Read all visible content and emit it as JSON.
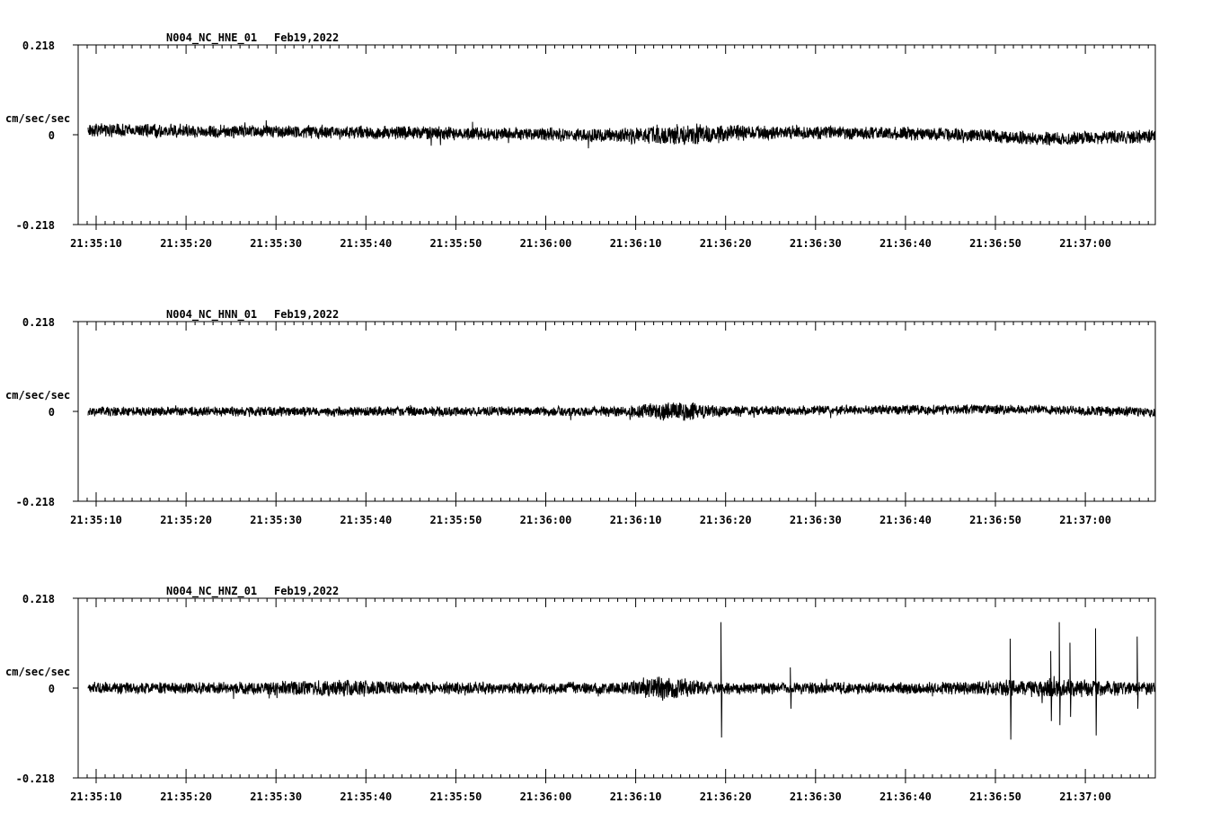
{
  "chart_data": [
    {
      "type": "line",
      "title": "N004_NC_HNE_01",
      "date": "Feb19,2022",
      "ylabel": "cm/sec/sec",
      "ylim": [
        -0.218,
        0.218
      ],
      "y_tick_labels": [
        "0.218",
        "0",
        "-0.218"
      ],
      "x_tick_labels": [
        "21:35:10",
        "21:35:20",
        "21:35:30",
        "21:35:40",
        "21:35:50",
        "21:36:00",
        "21:36:10",
        "21:36:20",
        "21:36:30",
        "21:36:40",
        "21:36:50",
        "21:37:00"
      ],
      "x_range": [
        "21:35:09",
        "21:37:08"
      ],
      "trace": {
        "noise_amplitude": 0.018,
        "drift": [
          [
            0,
            0.012
          ],
          [
            0.15,
            0.008
          ],
          [
            0.33,
            0.004
          ],
          [
            0.5,
            -0.002
          ],
          [
            0.67,
            0.006
          ],
          [
            0.8,
            0.002
          ],
          [
            0.9,
            -0.01
          ],
          [
            1,
            -0.004
          ]
        ],
        "bursts": [
          {
            "t": 0.56,
            "width": 0.05,
            "gain": 1.6
          }
        ],
        "spikes": []
      },
      "color": "#000000"
    },
    {
      "type": "line",
      "title": "N004_NC_HNN_01",
      "date": "Feb19,2022",
      "ylabel": "cm/sec/sec",
      "ylim": [
        -0.218,
        0.218
      ],
      "y_tick_labels": [
        "0.218",
        "0",
        "-0.218"
      ],
      "x_tick_labels": [
        "21:35:10",
        "21:35:20",
        "21:35:30",
        "21:35:40",
        "21:35:50",
        "21:36:00",
        "21:36:10",
        "21:36:20",
        "21:36:30",
        "21:36:40",
        "21:36:50",
        "21:37:00"
      ],
      "x_range": [
        "21:35:09",
        "21:37:08"
      ],
      "trace": {
        "noise_amplitude": 0.013,
        "drift": [
          [
            0,
            0.0
          ],
          [
            0.5,
            0.0
          ],
          [
            0.88,
            0.005
          ],
          [
            1,
            -0.002
          ]
        ],
        "bursts": [
          {
            "t": 0.55,
            "width": 0.035,
            "gain": 2.0
          }
        ],
        "spikes": []
      },
      "color": "#000000"
    },
    {
      "type": "line",
      "title": "N004_NC_HNZ_01",
      "date": "Feb19,2022",
      "ylabel": "cm/sec/sec",
      "ylim": [
        -0.218,
        0.218
      ],
      "y_tick_labels": [
        "0.218",
        "0",
        "-0.218"
      ],
      "x_tick_labels": [
        "21:35:10",
        "21:35:20",
        "21:35:30",
        "21:35:40",
        "21:35:50",
        "21:36:00",
        "21:36:10",
        "21:36:20",
        "21:36:30",
        "21:36:40",
        "21:36:50",
        "21:37:00"
      ],
      "x_range": [
        "21:35:09",
        "21:37:08"
      ],
      "trace": {
        "noise_amplitude": 0.016,
        "drift": [
          [
            0,
            0.0
          ],
          [
            1,
            0.0
          ]
        ],
        "bursts": [
          {
            "t": 0.24,
            "width": 0.06,
            "gain": 1.4
          },
          {
            "t": 0.54,
            "width": 0.03,
            "gain": 2.0
          },
          {
            "t": 0.91,
            "width": 0.06,
            "gain": 1.6
          }
        ],
        "spikes": [
          {
            "t": 0.593,
            "up": 0.16,
            "down": -0.12
          },
          {
            "t": 0.658,
            "up": 0.05,
            "down": -0.05
          },
          {
            "t": 0.864,
            "up": 0.12,
            "down": -0.125
          },
          {
            "t": 0.902,
            "up": 0.09,
            "down": -0.08
          },
          {
            "t": 0.91,
            "up": 0.16,
            "down": -0.09
          },
          {
            "t": 0.92,
            "up": 0.11,
            "down": -0.07
          },
          {
            "t": 0.944,
            "up": 0.145,
            "down": -0.115
          },
          {
            "t": 0.983,
            "up": 0.125,
            "down": -0.05
          }
        ]
      },
      "color": "#000000"
    }
  ]
}
